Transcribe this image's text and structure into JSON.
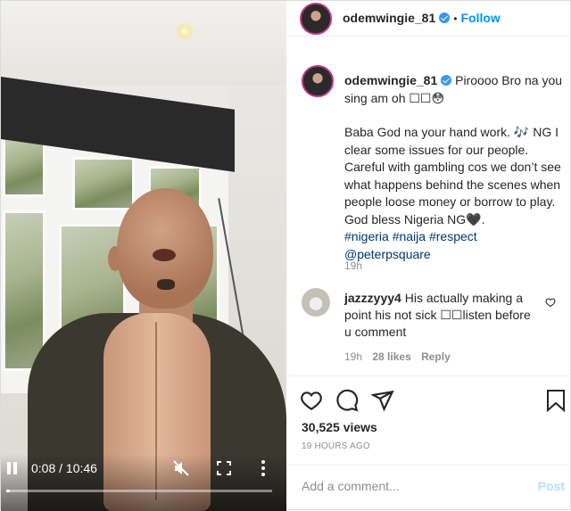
{
  "header": {
    "username": "odemwingie_81",
    "separator": "•",
    "follow_label": "Follow"
  },
  "caption": {
    "username": "odemwingie_81",
    "line1": "Piroooo Bro na you sing am oh ☐☐😳",
    "body": "Baba God na your hand work. 🎶 NG I clear some issues for our people. Careful with gambling cos we don’t see what happens behind the scenes when people loose money or borrow to play. God bless Nigeria NG🖤.",
    "hashtags": "#nigeria #naija #respect",
    "mention": "@peterpsquare",
    "time": "19h"
  },
  "comment": {
    "username": "jazzzyyy4",
    "text": "His actually making a point his not sick ☐☐listen before u comment",
    "time": "19h",
    "likes": "28 likes",
    "reply": "Reply"
  },
  "views": "30,525 views",
  "posted": "19 HOURS AGO",
  "add_comment": {
    "placeholder": "Add a comment...",
    "post_label": "Post"
  },
  "video": {
    "time": "0:08 / 10:46",
    "progress": 0.012
  },
  "colors": {
    "link": "#0095f6",
    "verified": "#3897f0",
    "hashtag": "#00376b",
    "muted": "#8e8e8e"
  }
}
